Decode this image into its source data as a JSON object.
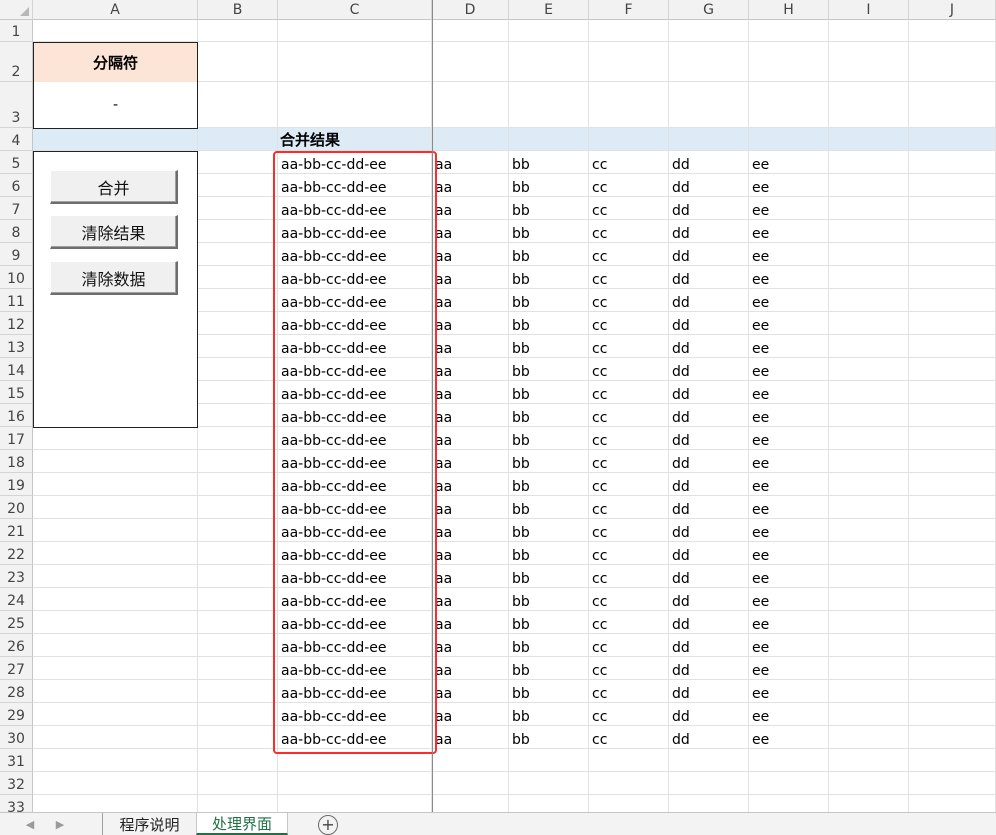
{
  "columns": [
    "A",
    "B",
    "C",
    "D",
    "E",
    "F",
    "G",
    "H",
    "I",
    "J"
  ],
  "rows": [
    "1",
    "2",
    "3",
    "4",
    "5",
    "6",
    "7",
    "8",
    "9",
    "10",
    "11",
    "12",
    "13",
    "14",
    "15",
    "16",
    "17",
    "18",
    "19",
    "20",
    "21",
    "22",
    "23",
    "24",
    "25",
    "26",
    "27",
    "28",
    "29",
    "30",
    "31",
    "32",
    "33"
  ],
  "separator": {
    "label": "分隔符",
    "value": "-"
  },
  "result_header": "合并结果",
  "buttons": {
    "merge": "合并",
    "clear_result": "清除结果",
    "clear_data": "清除数据"
  },
  "merged_values": [
    "aa-bb-cc-dd-ee",
    "aa-bb-cc-dd-ee",
    "aa-bb-cc-dd-ee",
    "aa-bb-cc-dd-ee",
    "aa-bb-cc-dd-ee",
    "aa-bb-cc-dd-ee",
    "aa-bb-cc-dd-ee",
    "aa-bb-cc-dd-ee",
    "aa-bb-cc-dd-ee",
    "aa-bb-cc-dd-ee",
    "aa-bb-cc-dd-ee",
    "aa-bb-cc-dd-ee",
    "aa-bb-cc-dd-ee",
    "aa-bb-cc-dd-ee",
    "aa-bb-cc-dd-ee",
    "aa-bb-cc-dd-ee",
    "aa-bb-cc-dd-ee",
    "aa-bb-cc-dd-ee",
    "aa-bb-cc-dd-ee",
    "aa-bb-cc-dd-ee",
    "aa-bb-cc-dd-ee",
    "aa-bb-cc-dd-ee",
    "aa-bb-cc-dd-ee",
    "aa-bb-cc-dd-ee",
    "aa-bb-cc-dd-ee",
    "aa-bb-cc-dd-ee"
  ],
  "source_row": [
    "aa",
    "bb",
    "cc",
    "dd",
    "ee"
  ],
  "sheet_tabs": [
    {
      "label": "程序说明",
      "active": false
    },
    {
      "label": "处理界面",
      "active": true
    }
  ],
  "colors": {
    "header_fill": "#fce4d6",
    "band_fill": "#ddebf7",
    "highlight": "#ff2a2a",
    "active_tab": "#1e7145"
  },
  "icons": {
    "scroll_left": "triangle-left-icon",
    "scroll_right": "triangle-right-icon",
    "add_sheet": "plus-circle-icon"
  }
}
